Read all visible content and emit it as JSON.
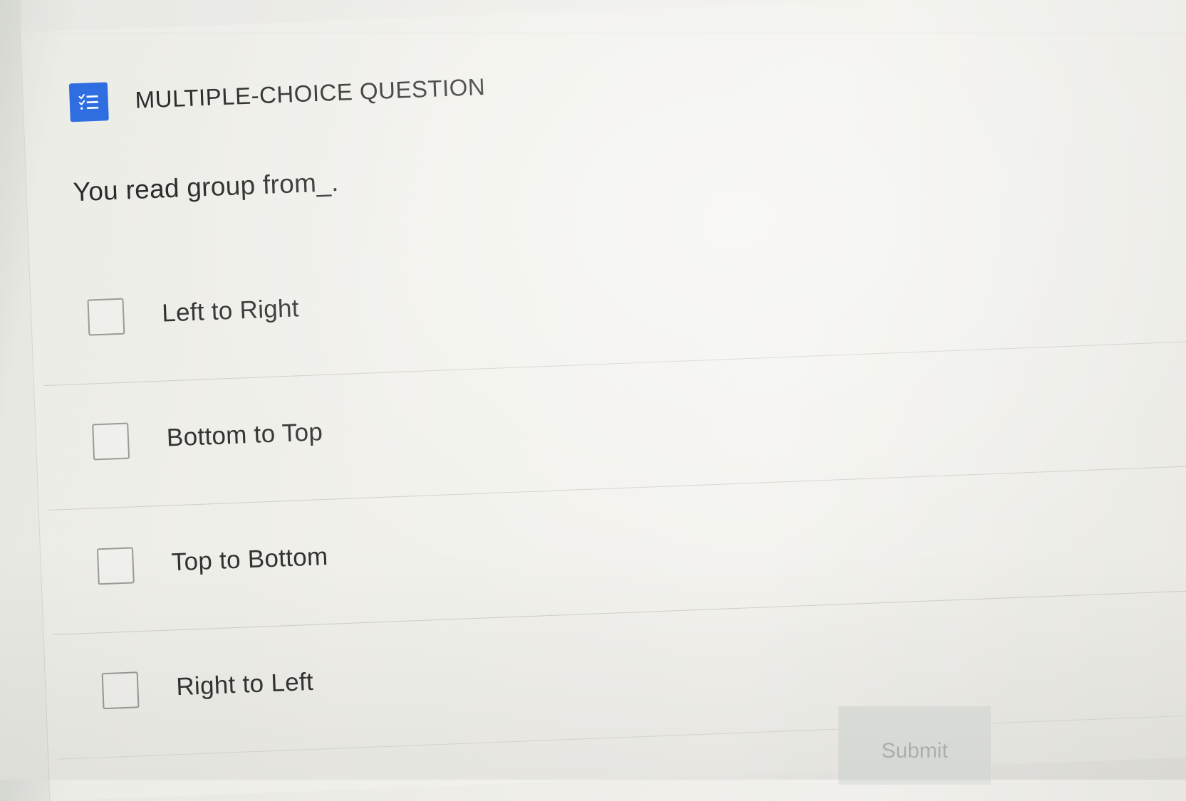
{
  "question_card": {
    "type_label": "MULTIPLE-CHOICE QUESTION",
    "type_icon": "checklist-icon",
    "accent_color": "#2e6ee0",
    "question_text": "You read group from_.",
    "options": [
      {
        "label": "Left to Right",
        "checked": false
      },
      {
        "label": "Bottom to Top",
        "checked": false
      },
      {
        "label": "Top to Bottom",
        "checked": false
      },
      {
        "label": "Right to Left",
        "checked": false
      }
    ],
    "submit_label": "Submit"
  }
}
